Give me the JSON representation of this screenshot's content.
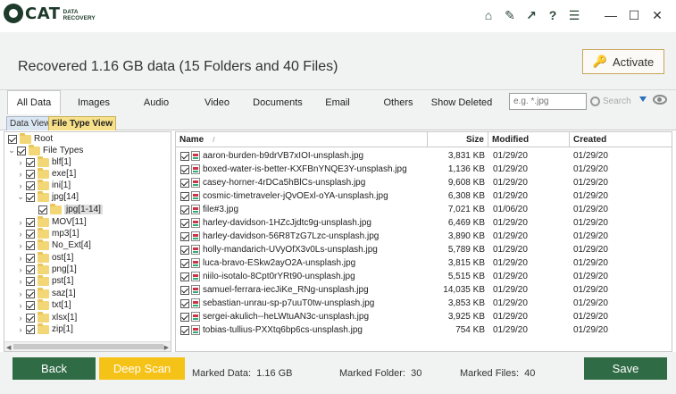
{
  "app": {
    "logo_text": "CAT",
    "logo_sub_line1": "DATA",
    "logo_sub_line2": "RECOVERY"
  },
  "titlebar_icons": [
    "home-icon",
    "tools-icon",
    "share-arrow-icon",
    "help-icon",
    "menu-icon",
    "minimize-icon",
    "maximize-icon",
    "close-icon"
  ],
  "header": {
    "title": "Recovered 1.16 GB data (15 Folders and 40 Files)",
    "activate_label": "Activate"
  },
  "tabs": [
    "All Data",
    "Images",
    "Audio",
    "Video",
    "Documents",
    "Email",
    "Others",
    "Show Deleted"
  ],
  "search": {
    "placeholder": "e.g. *.jpg",
    "button_label": "Search"
  },
  "view_tabs": {
    "data_view": "Data View",
    "file_type_view": "File Type View"
  },
  "tree": {
    "root": "Root",
    "file_types": "File Types",
    "items": [
      "blf[1]",
      "exe[1]",
      "ini[1]",
      "jpg[14]",
      "jpg[1-14]",
      "MOV[11]",
      "mp3[1]",
      "No_Ext[4]",
      "ost[1]",
      "png[1]",
      "pst[1]",
      "saz[1]",
      "txt[1]",
      "xlsx[1]",
      "zip[1]"
    ]
  },
  "filelist": {
    "columns": {
      "name": "Name",
      "sort_indicator": "/",
      "size": "Size",
      "modified": "Modified",
      "created": "Created"
    },
    "rows": [
      {
        "name": "aaron-burden-b9drVB7xIOI-unsplash.jpg",
        "size": "3,831 KB",
        "modified": "01/29/20",
        "created": "01/29/20"
      },
      {
        "name": "boxed-water-is-better-KXFBnYNQE3Y-unsplash.jpg",
        "size": "1,136 KB",
        "modified": "01/29/20",
        "created": "01/29/20"
      },
      {
        "name": "casey-horner-4rDCa5hBlCs-unsplash.jpg",
        "size": "9,608 KB",
        "modified": "01/29/20",
        "created": "01/29/20"
      },
      {
        "name": "cosmic-timetraveler-jQvOExl-oYA-unsplash.jpg",
        "size": "6,308 KB",
        "modified": "01/29/20",
        "created": "01/29/20"
      },
      {
        "name": "file#3.jpg",
        "size": "7,021 KB",
        "modified": "01/06/20",
        "created": "01/29/20"
      },
      {
        "name": "harley-davidson-1HZcJjdtc9g-unsplash.jpg",
        "size": "6,469 KB",
        "modified": "01/29/20",
        "created": "01/29/20"
      },
      {
        "name": "harley-davidson-56R8TzG7Lzc-unsplash.jpg",
        "size": "3,890 KB",
        "modified": "01/29/20",
        "created": "01/29/20"
      },
      {
        "name": "holly-mandarich-UVyOfX3v0Ls-unsplash.jpg",
        "size": "5,789 KB",
        "modified": "01/29/20",
        "created": "01/29/20"
      },
      {
        "name": "luca-bravo-ESkw2ayO2A-unsplash.jpg",
        "size": "3,815 KB",
        "modified": "01/29/20",
        "created": "01/29/20"
      },
      {
        "name": "niilo-isotalo-8Cpt0rYRt90-unsplash.jpg",
        "size": "5,515 KB",
        "modified": "01/29/20",
        "created": "01/29/20"
      },
      {
        "name": "samuel-ferrara-iecJiKe_RNg-unsplash.jpg",
        "size": "14,035 KB",
        "modified": "01/29/20",
        "created": "01/29/20"
      },
      {
        "name": "sebastian-unrau-sp-p7uuT0tw-unsplash.jpg",
        "size": "3,853 KB",
        "modified": "01/29/20",
        "created": "01/29/20"
      },
      {
        "name": "sergei-akulich--heLWtuAN3c-unsplash.jpg",
        "size": "3,925 KB",
        "modified": "01/29/20",
        "created": "01/29/20"
      },
      {
        "name": "tobias-tullius-PXXtq6bp6cs-unsplash.jpg",
        "size": "754 KB",
        "modified": "01/29/20",
        "created": "01/29/20"
      }
    ]
  },
  "footer": {
    "back_label": "Back",
    "deep_scan_label": "Deep Scan",
    "marked_data_label": "Marked Data:",
    "marked_data_value": "1.16 GB",
    "marked_folder_label": "Marked Folder:",
    "marked_folder_value": "30",
    "marked_files_label": "Marked Files:",
    "marked_files_value": "40",
    "save_label": "Save"
  },
  "colors": {
    "brand_green": "#2f6b45",
    "deep_scan_gold": "#f5c217",
    "activate_border": "#c9a45a",
    "active_view_tab": "#f7e08a"
  }
}
